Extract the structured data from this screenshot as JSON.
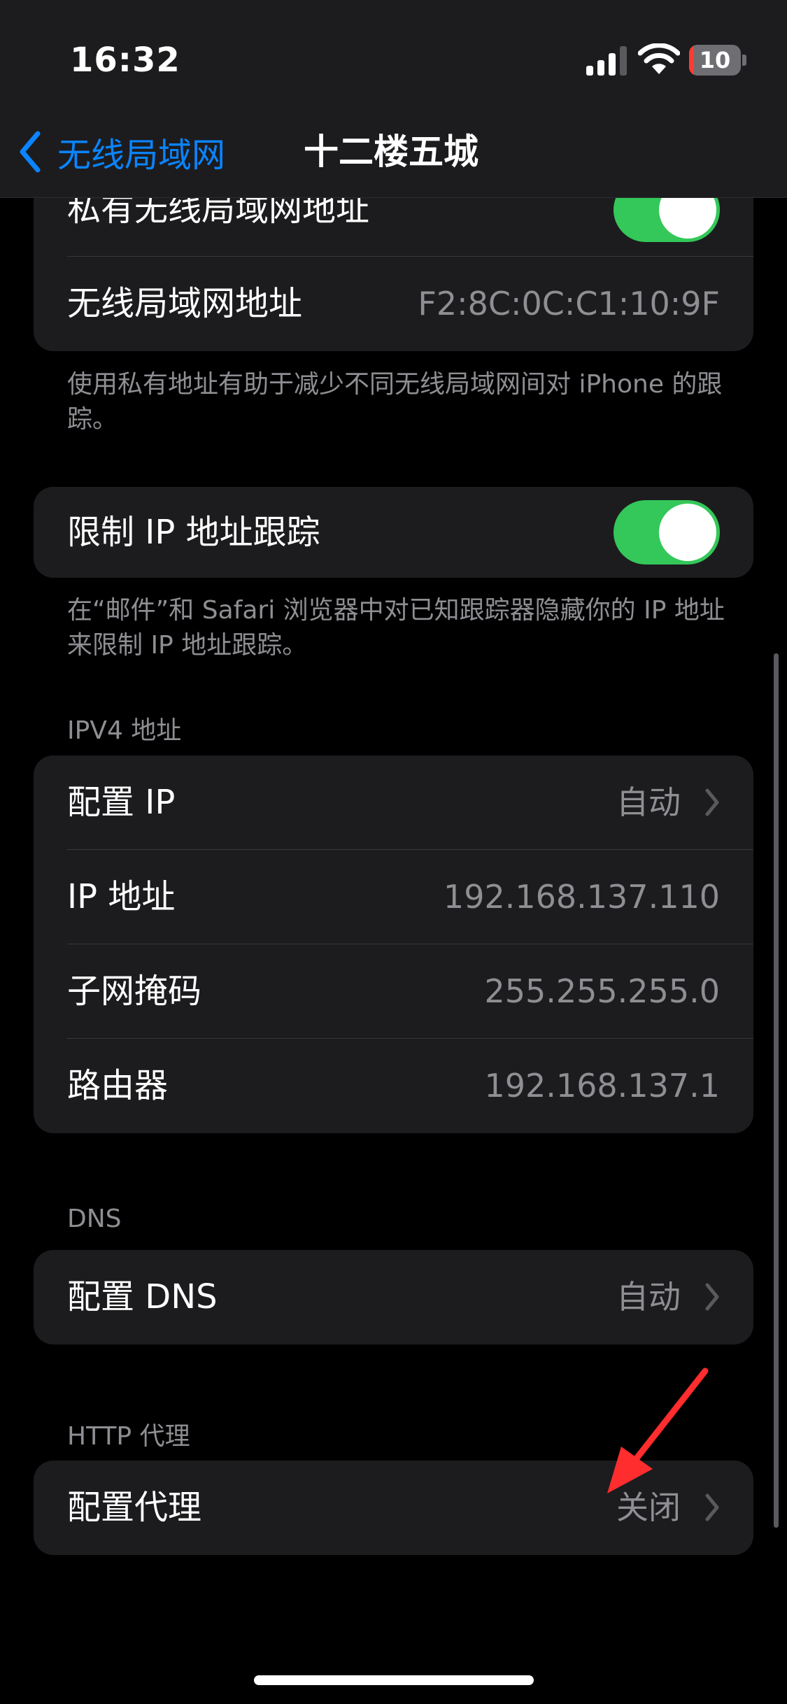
{
  "status": {
    "time": "16:32",
    "battery": "10",
    "battery_level": 0.1,
    "battery_low_color": "#ff3b30"
  },
  "nav": {
    "back_label": "无线局域网",
    "title": "十二楼五城"
  },
  "privacy": {
    "private_address_label": "私有无线局域网地址",
    "private_address_on": true,
    "wlan_address_label": "无线局域网地址",
    "wlan_address_value": "F2:8C:0C:C1:10:9F",
    "footer": "使用私有地址有助于减少不同无线局域网间对 iPhone 的跟踪。"
  },
  "limit_ip": {
    "label": "限制 IP 地址跟踪",
    "on": true,
    "footer": "在“邮件”和 Safari 浏览器中对已知跟踪器隐藏你的 IP 地址来限制 IP 地址跟踪。"
  },
  "ipv4": {
    "header": "IPV4 地址",
    "rows": [
      {
        "label": "配置 IP",
        "value": "自动"
      },
      {
        "label": "IP 地址",
        "value": "192.168.137.110"
      },
      {
        "label": "子网掩码",
        "value": "255.255.255.0"
      },
      {
        "label": "路由器",
        "value": "192.168.137.1"
      }
    ]
  },
  "dns": {
    "header": "DNS",
    "label": "配置 DNS",
    "value": "自动"
  },
  "proxy": {
    "header": "HTTP 代理",
    "label": "配置代理",
    "value": "关闭"
  },
  "colors": {
    "accent": "#0a84ff",
    "toggle_on": "#34c759",
    "annotation_arrow": "#ff2d2d"
  },
  "icons": [
    "chevron-left-icon",
    "chevron-right-icon",
    "signal-icon",
    "wifi-icon",
    "battery-icon"
  ]
}
